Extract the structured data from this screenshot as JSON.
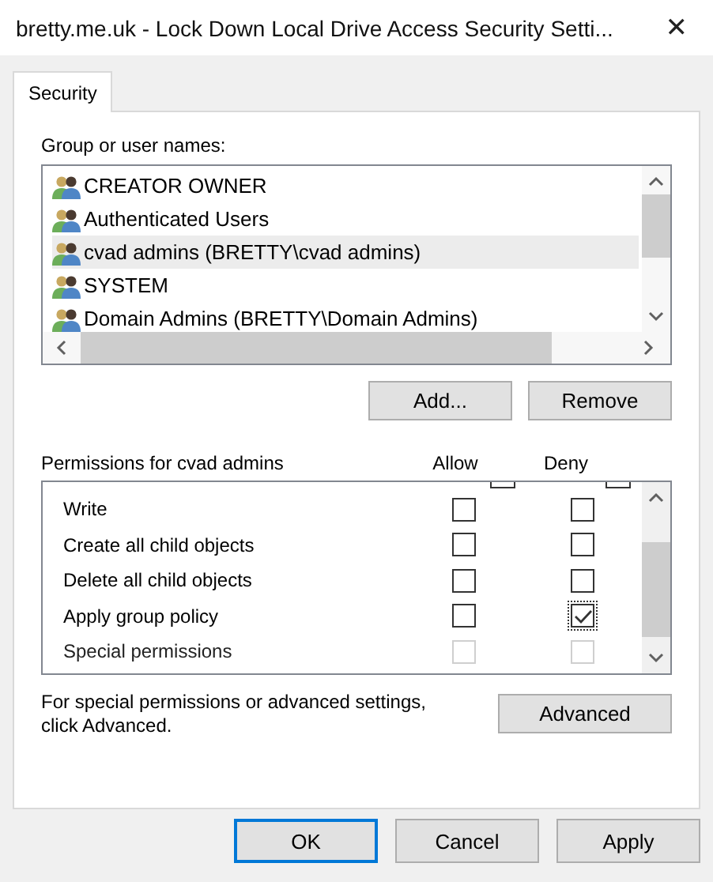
{
  "window": {
    "title": "bretty.me.uk - Lock Down Local Drive Access Security Setti...",
    "close": "✕"
  },
  "tabs": [
    {
      "label": "Security",
      "selected": true
    }
  ],
  "users": {
    "label": "Group or user names:",
    "items": [
      {
        "name": "CREATOR OWNER",
        "selected": false
      },
      {
        "name": "Authenticated Users",
        "selected": false
      },
      {
        "name": "cvad admins (BRETTY\\cvad admins)",
        "selected": true
      },
      {
        "name": "SYSTEM",
        "selected": false
      },
      {
        "name": "Domain Admins (BRETTY\\Domain Admins)",
        "selected": false
      }
    ],
    "buttons": [
      "Add...",
      "Remove"
    ]
  },
  "permissions": {
    "label": "Permissions for cvad admins",
    "columns": [
      "Allow",
      "Deny"
    ],
    "rows": [
      {
        "name": "Write",
        "allow": false,
        "deny": false,
        "disabled": false,
        "focused": false
      },
      {
        "name": "Create all child objects",
        "allow": false,
        "deny": false,
        "disabled": false,
        "focused": false
      },
      {
        "name": "Delete all child objects",
        "allow": false,
        "deny": false,
        "disabled": false,
        "focused": false
      },
      {
        "name": "Apply group policy",
        "allow": false,
        "deny": true,
        "disabled": false,
        "focused": true
      },
      {
        "name": "Special permissions",
        "allow": false,
        "deny": false,
        "disabled": true,
        "focused": false
      }
    ]
  },
  "advanced": {
    "note": "For special permissions or advanced settings, click Advanced.",
    "button": "Advanced"
  },
  "footer": [
    {
      "label": "OK",
      "default": true
    },
    {
      "label": "Cancel",
      "default": false
    },
    {
      "label": "Apply",
      "default": false
    }
  ]
}
